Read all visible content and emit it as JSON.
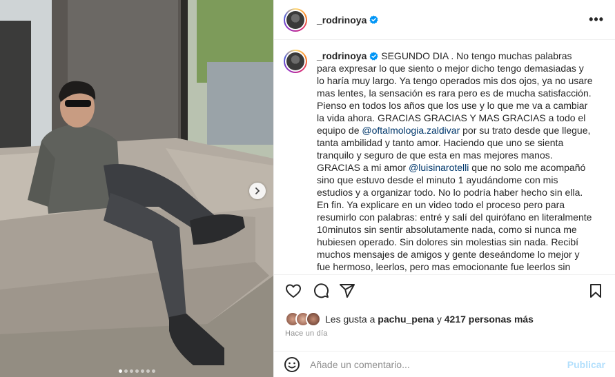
{
  "post": {
    "username": "_rodrinoya",
    "caption_paragraphs": [
      {
        "parts": [
          {
            "t": "SEGUNDO DIA . No tengo muchas palabras para expresar lo que siento o mejor dicho tengo demasiadas y lo haría muy largo. Ya tengo operados mis dos ojos, ya no usare mas lentes, la sensación es rara pero es de mucha satisfacción. Pienso en todos los años que los use y lo que me va a cambiar la vida ahora. GRACIAS GRACIAS Y MAS GRACIAS a todo el equipo de "
          },
          {
            "m": "@oftalmologia.zaldivar"
          },
          {
            "t": " por su trato desde que llegue, tanta ambilidad y tanto amor. Haciendo que uno se sienta tranquilo y seguro de que esta en mas mejores manos."
          }
        ]
      },
      {
        "parts": [
          {
            "t": "GRACIAS a mi amor "
          },
          {
            "m": "@luisinarotelli"
          },
          {
            "t": " que no solo me acompañó sino que estuvo desde el minuto 1 ayudándome con mis estudios y a organizar todo. No lo podría haber hecho sin ella."
          }
        ]
      },
      {
        "parts": [
          {
            "t": "En fin. Ya explicare en un video todo el proceso pero para resumirlo con palabras: entré y salí del quirófano en literalmente 10minutos sin sentir absolutamente nada, como si nunca me hubiesen operado. Sin dolores sin molestias sin nada. Recibí muchos mensajes de amigos y gente deseándome lo mejor y fue hermoso, leerlos, pero mas emocionante fue leerlos sin anteojos"
          }
        ]
      }
    ],
    "likes": {
      "prefix": "Les gusta a",
      "user": "pachu_pena",
      "mid": "y",
      "count": "4217 personas más"
    },
    "time": "Hace un día",
    "comment_placeholder": "Añade un comentario...",
    "publish_label": "Publicar",
    "more_label": "•••"
  },
  "carousel": {
    "count": 7,
    "active": 0
  },
  "icons": {
    "like": "heart-icon",
    "comment": "comment-icon",
    "share": "share-icon",
    "save": "bookmark-icon",
    "emoji": "emoji-icon",
    "next": "chevron-right-icon",
    "verified": "verified-badge-icon",
    "more": "more-options-icon"
  },
  "colors": {
    "verified": "#0095f6",
    "mention": "#00376b",
    "publish": "#b2dffc",
    "muted": "#8e8e8e"
  }
}
